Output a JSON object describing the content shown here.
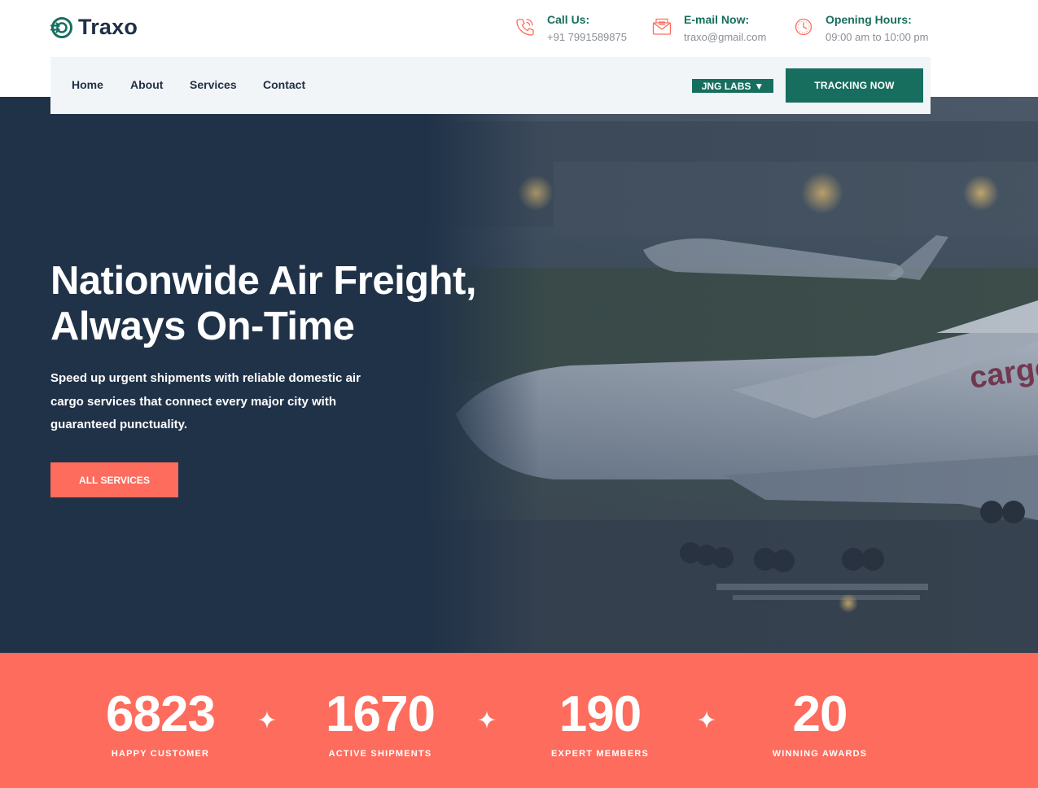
{
  "brand": {
    "name": "Traxo",
    "logo_icon": "target-arrow-logo-icon"
  },
  "header_contacts": [
    {
      "title": "Call Us:",
      "value": "+91 7991589875",
      "icon": "phone-icon"
    },
    {
      "title": "E-mail Now:",
      "value": "traxo@gmail.com",
      "icon": "envelope-icon"
    },
    {
      "title": "Opening Hours:",
      "value": "09:00 am to 10:00 pm",
      "icon": "clock-icon"
    }
  ],
  "nav": {
    "items": [
      "Home",
      "About",
      "Services",
      "Contact"
    ],
    "language_label": "JNG LABS",
    "language_caret": "▼",
    "tracking_button": "TRACKING NOW"
  },
  "hero": {
    "title_line1": "Nationwide Air Freight,",
    "title_line2": "Always On-Time",
    "description": "Speed up urgent shipments with reliable domestic air cargo services that connect every major city with guaranteed punctuality.",
    "button_label": "ALL SERVICES",
    "aircraft_livery": "cargo"
  },
  "stats": [
    {
      "value": "6823",
      "label": "HAPPY CUSTOMER"
    },
    {
      "value": "1670",
      "label": "ACTIVE SHIPMENTS"
    },
    {
      "value": "190",
      "label": "EXPERT MEMBERS"
    },
    {
      "value": "20",
      "label": "WINNING AWARDS"
    }
  ],
  "colors": {
    "primary_green": "#176e5f",
    "accent_coral": "#fd6c5d",
    "dark_navy": "#203248",
    "nav_bg": "#f2f5f7"
  }
}
